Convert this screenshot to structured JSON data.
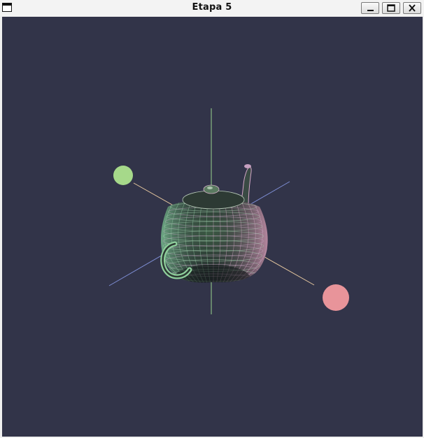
{
  "window": {
    "title": "Etapa 5",
    "controls": [
      "minimize",
      "maximize",
      "close"
    ]
  },
  "scene": {
    "background_color": "#323449",
    "object": "teapot",
    "render_style": "wireframe",
    "lights": [
      {
        "name": "light-green",
        "color": "#a6d98a"
      },
      {
        "name": "light-pink",
        "color": "#e8949a"
      }
    ],
    "axis_colors": {
      "vertical": "#9bd38e",
      "horizontal": "#e8c9a0",
      "depth": "#7f8fd6"
    }
  }
}
